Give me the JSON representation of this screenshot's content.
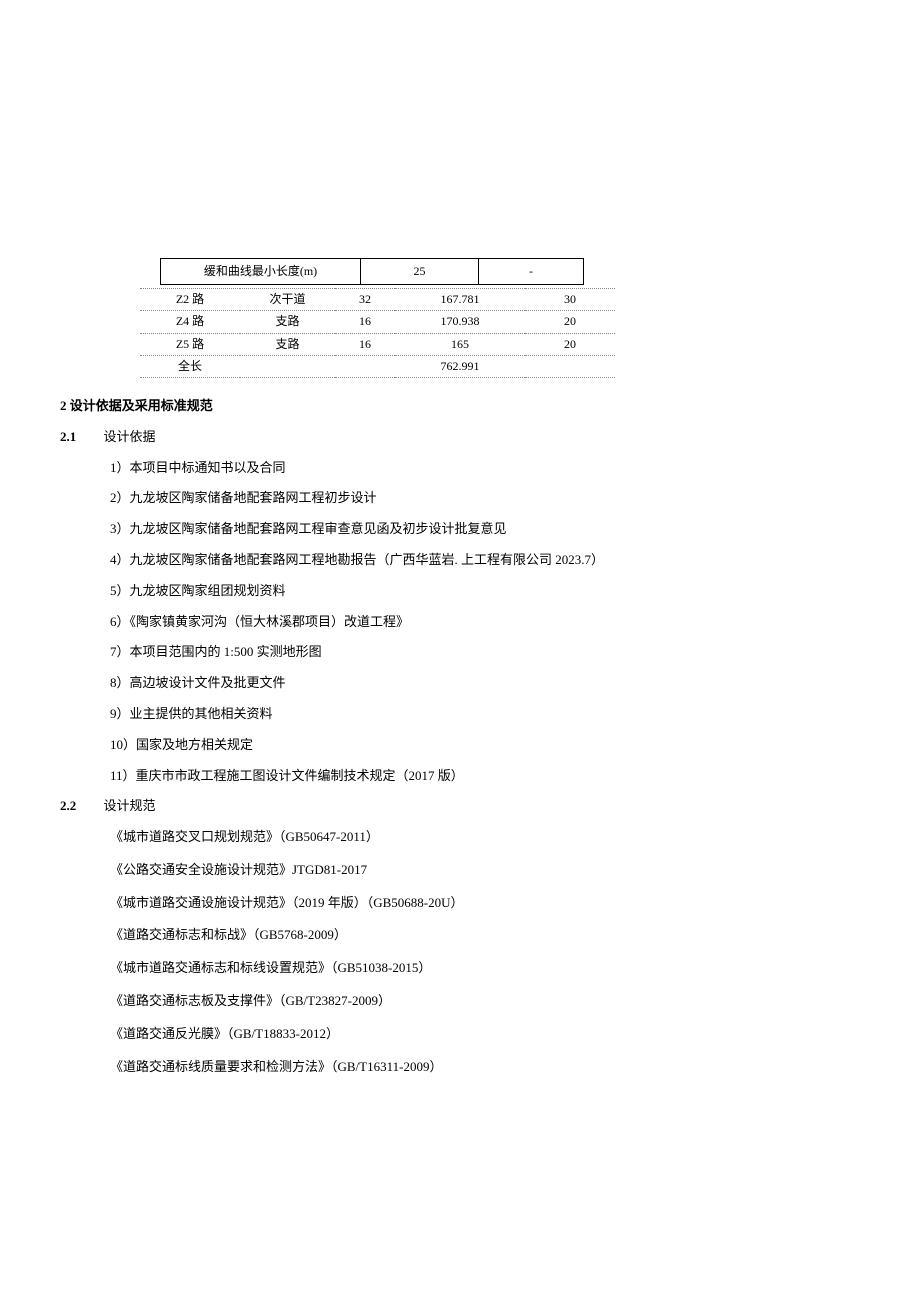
{
  "table1": {
    "rows": [
      [
        "缓和曲线最小长度(m)",
        "25",
        "-"
      ]
    ]
  },
  "table2": {
    "rows": [
      [
        "Z2 路",
        "次干道",
        "32",
        "167.781",
        "30"
      ],
      [
        "Z4 路",
        "支路",
        "16",
        "170.938",
        "20"
      ],
      [
        "Z5 路",
        "支路",
        "16",
        "165",
        "20"
      ],
      [
        "全长",
        "",
        "",
        "762.991",
        ""
      ]
    ]
  },
  "section2": {
    "heading": "2 设计依据及采用标准规范"
  },
  "section21": {
    "number": "2.1",
    "label": "设计依据",
    "items": [
      "1）本项目中标通知书以及合同",
      "2）九龙坡区陶家储备地配套路网工程初步设计",
      "3）九龙坡区陶家储备地配套路网工程审查意见函及初步设计批复意见",
      "4）九龙坡区陶家储备地配套路网工程地勘报告（广西华蓝岩. 上工程有限公司 2023.7）",
      "5）九龙坡区陶家组团规划资料",
      "6）《陶家镇黄家河沟（恒大林溪郡项目）改道工程》",
      "7）本项目范围内的 1:500 实测地形图",
      "8）高边坡设计文件及批更文件",
      "9）业主提供的其他相关资料",
      "10）国家及地方相关规定",
      "11）重庆市市政工程施工图设计文件编制技术规定（2017 版）"
    ]
  },
  "section22": {
    "number": "2.2",
    "label": "设计规范",
    "specs": [
      "《城市道路交叉口规划规范》（GB50647-2011）",
      "《公路交通安全设施设计规范》JTGD81-2017",
      "《城市道路交通设施设计规范》（2019 年版）（GB50688-20U）",
      "《道路交通标志和标战》（GB5768-2009）",
      "《城市道路交通标志和标线设置规范》（GB51038-2015）",
      "《道路交通标志板及支撑件》（GB/T23827-2009）",
      "《道路交通反光膜》（GB/T18833-2012）",
      "《道路交通标线质量要求和检测方法》（GB/T16311-2009）"
    ]
  }
}
